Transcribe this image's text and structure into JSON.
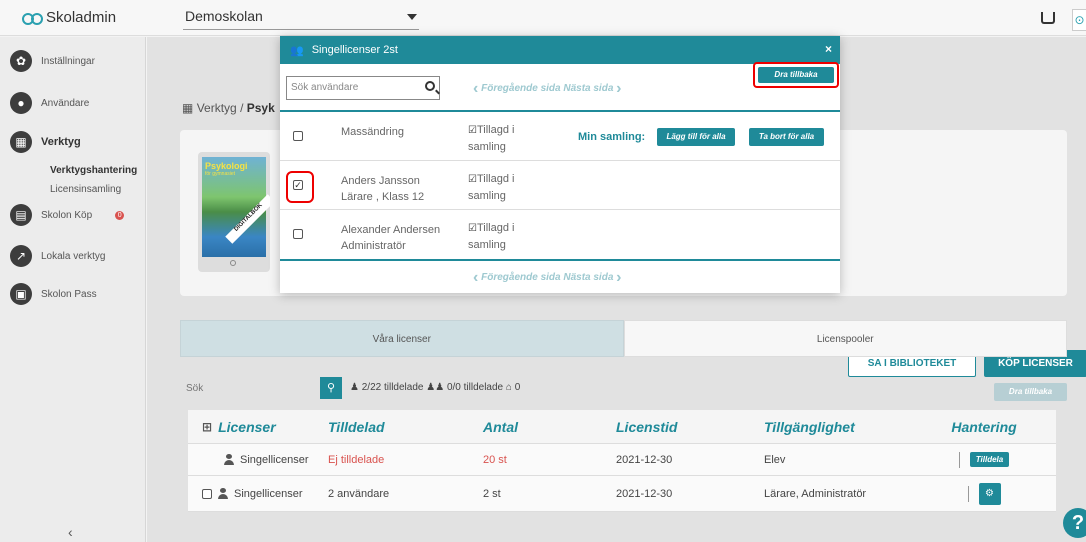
{
  "app": {
    "title": "Skoladmin"
  },
  "school_select": {
    "value": "Demoskolan"
  },
  "sidebar": {
    "items": [
      {
        "label": "Inställningar"
      },
      {
        "label": "Användare"
      },
      {
        "label": "Verktyg"
      },
      {
        "label": "Skolon Köp",
        "badge": "0"
      },
      {
        "label": "Lokala verktyg"
      },
      {
        "label": "Skolon Pass"
      }
    ],
    "sub_items": [
      {
        "label": "Verktygshantering"
      },
      {
        "label": "Licensinsamling"
      }
    ]
  },
  "breadcrumb": {
    "root": "Verktyg",
    "separator": "/",
    "current": "Psyk"
  },
  "product": {
    "cover_title": "Psykologi",
    "cover_subtitle": "för gymnasiet",
    "cover_tag": "DIGITALBOK",
    "btn_library": "SA I BIBLIOTEKET",
    "btn_buy": "KÖP LICENSER"
  },
  "tabs": [
    {
      "label": "Våra licenser"
    },
    {
      "label": "Licenspooler"
    }
  ],
  "search": {
    "placeholder": "Sök",
    "stats_users": "2/22 tilldelade",
    "stats_groups": "0/0 tilldelade",
    "stats_schools": "0",
    "btn_back": "Dra tillbaka"
  },
  "table": {
    "headers": [
      "Licenser",
      "Tilldelad",
      "Antal",
      "Licenstid",
      "Tillgänglighet",
      "Hantering"
    ],
    "rows": [
      {
        "name": "Singellicenser",
        "assigned": "Ej tilldelade",
        "count": "20 st",
        "time": "2021-12-30",
        "availability": "Elev",
        "action": "Tilldela"
      },
      {
        "name": "Singellicenser",
        "assigned": "2 användare",
        "count": "2 st",
        "time": "2021-12-30",
        "availability": "Lärare, Administratör",
        "action": ""
      }
    ]
  },
  "modal": {
    "title": "Singellicenser 2st",
    "close": "×",
    "search_placeholder": "Sök användare",
    "prev_page": "Föregående sida",
    "next_page": "Nästa sida",
    "btn_back": "Dra tillbaka",
    "collection_label": "Min samling:",
    "btn_add_all": "Lägg till för alla",
    "btn_remove_all": "Ta bort för alla",
    "rows": [
      {
        "name": "Massändring",
        "role": "",
        "added": "Tillagd i",
        "added2": "samling",
        "checked": false
      },
      {
        "name": "Anders Jansson",
        "role": "Lärare , Klass 12",
        "added": "Tillagd i",
        "added2": "samling",
        "checked": true
      },
      {
        "name": "Alexander Andersen",
        "role": "Administratör",
        "added": "Tillagd i",
        "added2": "samling",
        "checked": false
      }
    ]
  },
  "colors": {
    "accent": "#1f8a99",
    "alert": "#d9534f",
    "highlight": "#ee0000"
  },
  "icons": {
    "help": "?"
  }
}
